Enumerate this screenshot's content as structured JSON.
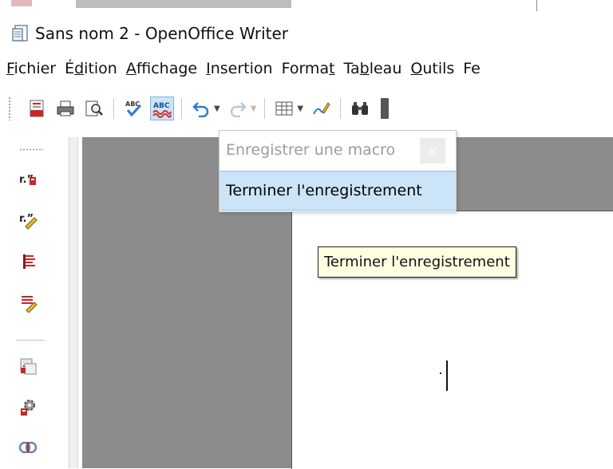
{
  "window": {
    "title": "Sans nom 2 - OpenOffice Writer"
  },
  "menubar": {
    "items": [
      {
        "label": "Fichier",
        "mnemonic_index": 0
      },
      {
        "label": "Édition",
        "mnemonic_index": 1
      },
      {
        "label": "Affichage",
        "mnemonic_index": 0
      },
      {
        "label": "Insertion",
        "mnemonic_index": 0
      },
      {
        "label": "Format",
        "mnemonic_index": 5
      },
      {
        "label": "Tableau",
        "mnemonic_index": 2
      },
      {
        "label": "Outils",
        "mnemonic_index": 0
      },
      {
        "label": "Fe",
        "mnemonic_index": -1
      }
    ]
  },
  "toolbar": {
    "icons": [
      "export-pdf-icon",
      "print-icon",
      "page-preview-icon",
      "spellcheck-icon",
      "auto-spellcheck-icon",
      "undo-icon",
      "redo-icon",
      "table-icon",
      "draw-functions-icon",
      "find-replace-icon"
    ]
  },
  "macro_menu": {
    "record_label": "Enregistrer une macro",
    "stop_label": "Terminer l'enregistrement",
    "close_symbol": "×"
  },
  "tooltip": {
    "text": "Terminer l'enregistrement"
  },
  "side_toolbar": {
    "icons": [
      "insert-field-icon",
      "edit-field-icon",
      "align-text-icon",
      "edit-paragraph-icon",
      "navigator-icon",
      "settings-icon",
      "link-icon"
    ]
  },
  "colors": {
    "accent_selection": "#cce4f7",
    "tooltip_bg": "#ffffe1",
    "canvas_gray": "#8c8c8c"
  }
}
